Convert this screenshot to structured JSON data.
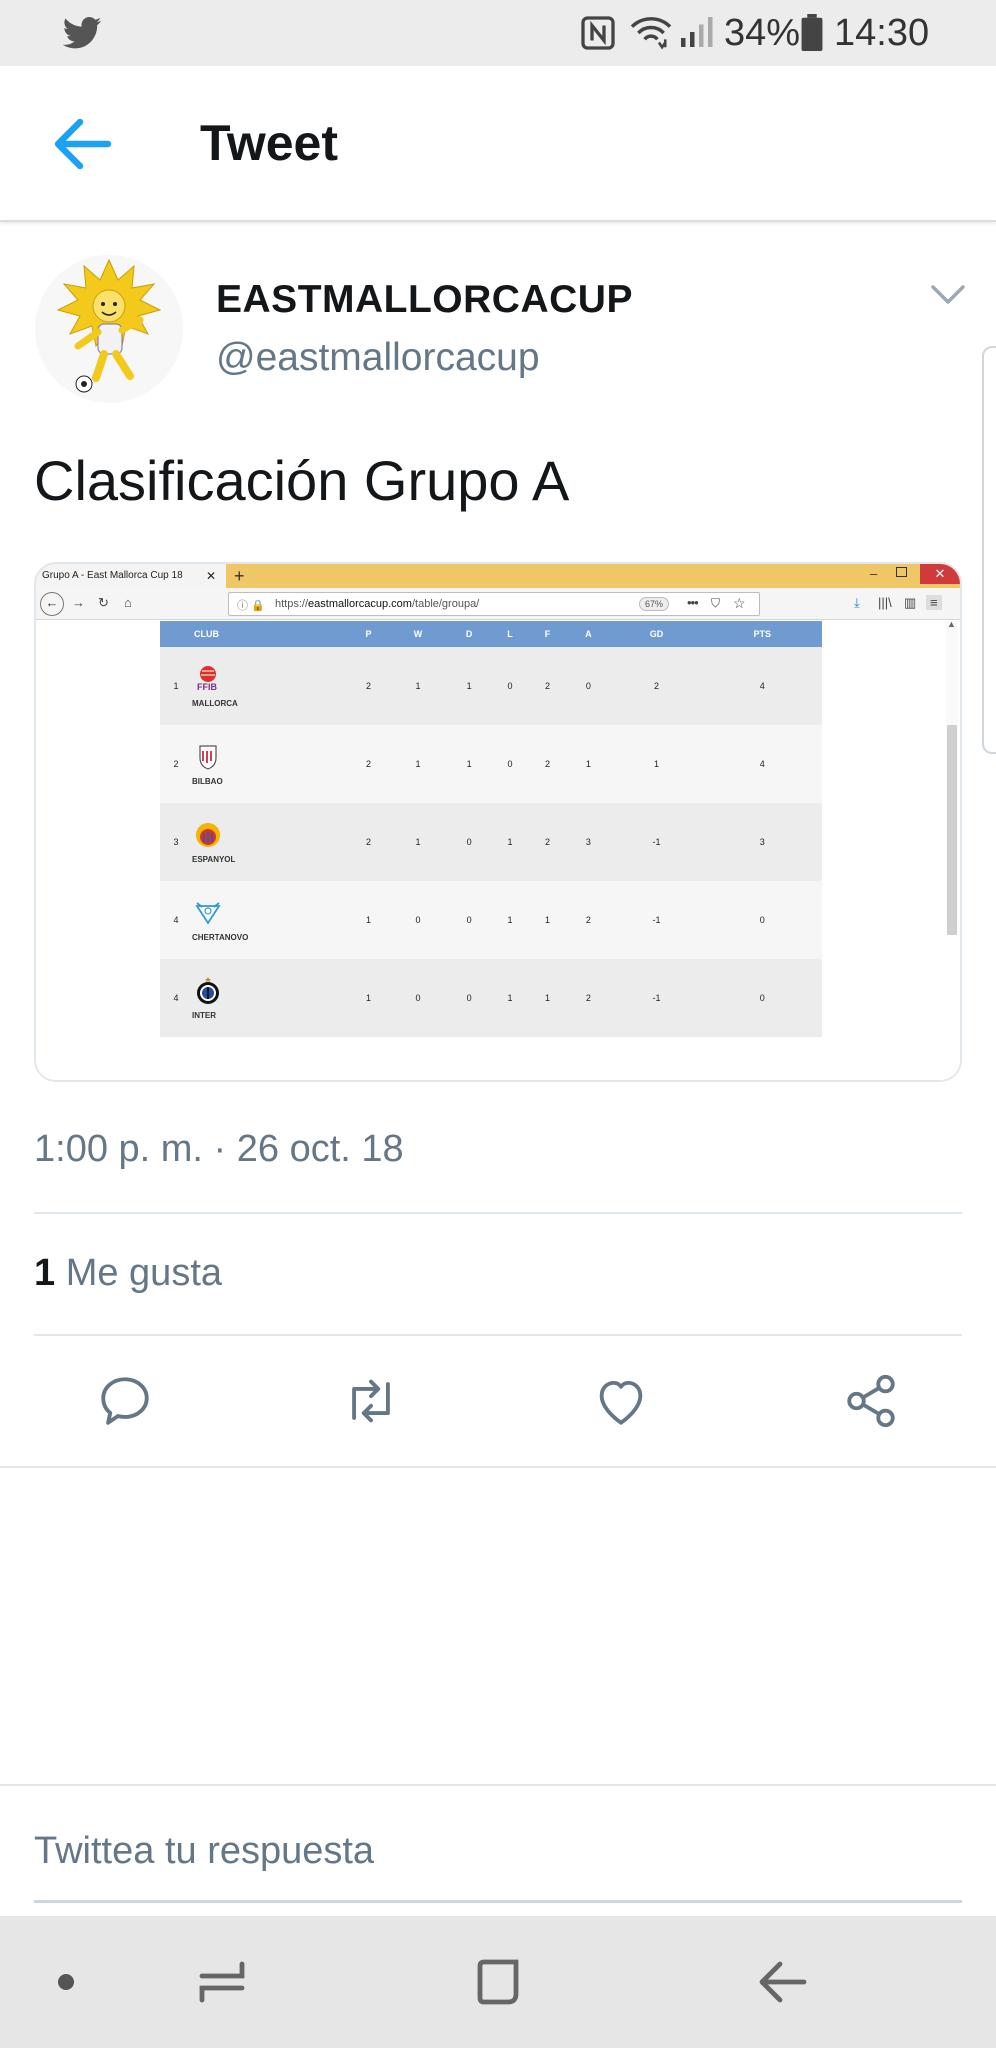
{
  "status_bar": {
    "battery": "34%",
    "time": "14:30",
    "icons": [
      "twitter-icon",
      "nfc-icon",
      "wifi-icon",
      "signal-icon",
      "battery-icon"
    ]
  },
  "header": {
    "title": "Tweet",
    "back_icon": "arrow-left-icon"
  },
  "tweet": {
    "author_name": "EASTMALLORCACUP",
    "author_handle": "@eastmallorcacup",
    "text": "Clasificación Grupo A",
    "timestamp": "1:00 p. m. · 26 oct. 18",
    "likes_count": "1",
    "likes_label": "Me gusta"
  },
  "media": {
    "tab_title": "Grupo A - East Mallorca Cup 18",
    "url_prefix": "https://",
    "url_domain": "eastmallorcacup.com",
    "url_path": "/table/groupa/",
    "zoom": "67%",
    "table": {
      "headers": [
        "CLUB",
        "P",
        "W",
        "D",
        "L",
        "F",
        "A",
        "GD",
        "PTS"
      ],
      "rows": [
        {
          "pos": "1",
          "club": "MALLORCA",
          "crest_text": "FFIB",
          "stats": [
            "2",
            "1",
            "1",
            "0",
            "2",
            "0",
            "2",
            "4"
          ]
        },
        {
          "pos": "2",
          "club": "BILBAO",
          "stats": [
            "2",
            "1",
            "1",
            "0",
            "2",
            "1",
            "1",
            "4"
          ]
        },
        {
          "pos": "3",
          "club": "ESPANYOL",
          "stats": [
            "2",
            "1",
            "0",
            "1",
            "2",
            "3",
            "-1",
            "3"
          ]
        },
        {
          "pos": "4",
          "club": "CHERTANOVO",
          "stats": [
            "1",
            "0",
            "0",
            "1",
            "1",
            "2",
            "-1",
            "0"
          ]
        },
        {
          "pos": "4",
          "club": "INTER",
          "stats": [
            "1",
            "0",
            "0",
            "1",
            "1",
            "2",
            "-1",
            "0"
          ]
        }
      ]
    }
  },
  "actions": [
    "reply-icon",
    "retweet-icon",
    "like-icon",
    "share-icon"
  ],
  "reply": {
    "placeholder": "Twittea tu respuesta"
  },
  "colors": {
    "accent": "#1da1f2",
    "muted": "#657786",
    "text": "#14171a",
    "table_header": "#6f9bd1",
    "browser_tabbar": "#efc766"
  }
}
